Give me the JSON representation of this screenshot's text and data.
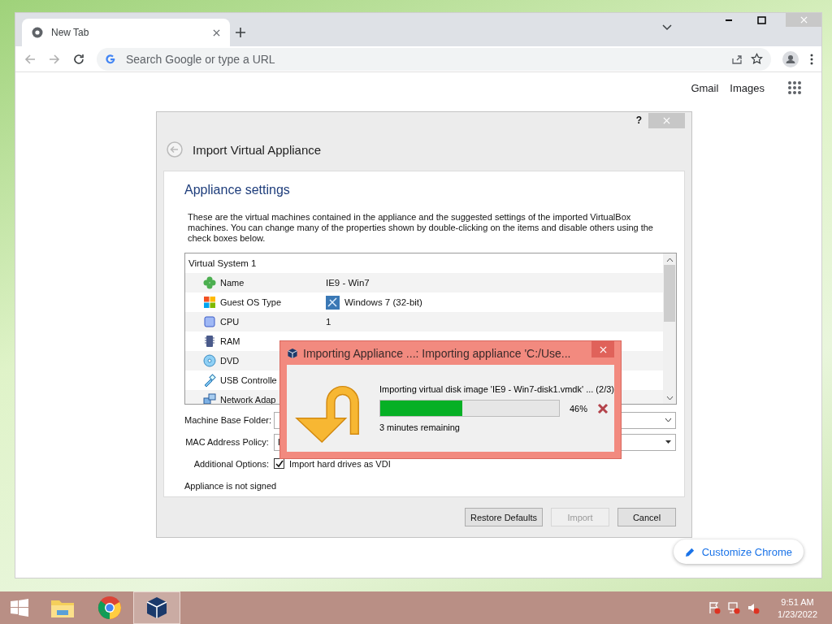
{
  "browser": {
    "tabs": [
      {
        "label": "New Tab",
        "selected": true
      }
    ],
    "address_bar": {
      "placeholder": "Search Google or type a URL"
    },
    "top_links": [
      "Gmail",
      "Images"
    ],
    "customize_button": "Customize Chrome"
  },
  "appliance_dialog": {
    "help": "?",
    "title": "Import Virtual Appliance",
    "heading": "Appliance settings",
    "description": "These are the virtual machines contained in the appliance and the suggested settings of the imported VirtualBox machines. You can change many of the properties shown by double-clicking on the items and disable others using the check boxes below.",
    "tree": {
      "label": "Virtual System 1",
      "children": [
        {
          "kind": "name",
          "label": "Name",
          "value": "IE9 - Win7"
        },
        {
          "kind": "os",
          "label": "Guest OS Type",
          "value": "Windows 7 (32-bit)"
        },
        {
          "kind": "cpu",
          "label": "CPU",
          "value": "1"
        },
        {
          "kind": "ram",
          "label": "RAM"
        },
        {
          "kind": "dvd",
          "label": "DVD"
        },
        {
          "kind": "usb",
          "label": "USB Controlle"
        },
        {
          "kind": "network",
          "label": "Network Adap"
        }
      ]
    },
    "fields": [
      {
        "kind": "folder",
        "label": "Machine Base Folder:"
      },
      {
        "kind": "select",
        "label": "MAC Address Policy:",
        "value": "I"
      }
    ],
    "option": {
      "label": "Additional Options:",
      "text": "Import hard drives as VDI",
      "checked": true
    },
    "signature": "Appliance is not signed",
    "buttons": [
      {
        "label": "Restore Defaults",
        "disabled": false
      },
      {
        "label": "Import",
        "disabled": true
      },
      {
        "label": "Cancel",
        "disabled": false
      }
    ]
  },
  "progress_dialog": {
    "title": "Importing Appliance ...: Importing appliance 'C:/Use...",
    "message": "Importing virtual disk image 'IE9 - Win7-disk1.vmdk' ... (2/3)",
    "level": 0.46,
    "percent": "46%",
    "remaining": "3 minutes remaining"
  },
  "taskbar": {
    "apps": [
      {
        "kind": "explorer",
        "selected": false
      },
      {
        "kind": "chrome",
        "selected": false
      },
      {
        "kind": "virtualbox",
        "selected": true
      }
    ],
    "time": "9:51 AM",
    "date": "1/23/2022"
  }
}
